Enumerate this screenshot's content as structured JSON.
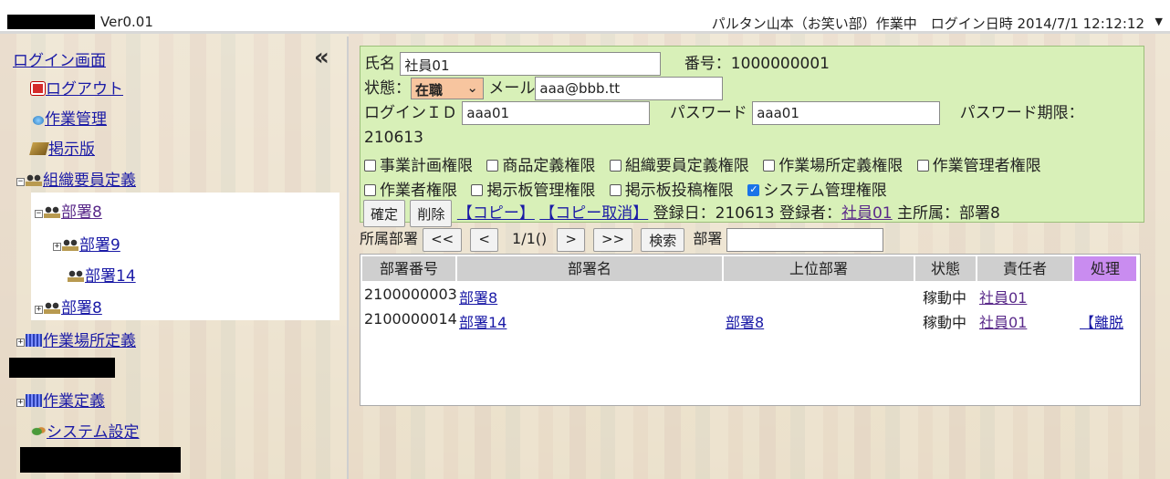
{
  "header": {
    "version": "Ver0.01",
    "status_text": "パルタン山本（お笑い部）作業中　ログイン日時 2014/7/1 12:12:12",
    "dropdown_icon": "triangle-down-icon"
  },
  "sidebar": {
    "collapse_icon": "«",
    "items": [
      {
        "label": "ログイン画面"
      },
      {
        "label": "ログアウト"
      },
      {
        "label": "作業管理"
      },
      {
        "label": "掲示版"
      },
      {
        "label": "組織要員定義"
      },
      {
        "label": "部署8"
      },
      {
        "label": "部署9"
      },
      {
        "label": "部署14"
      },
      {
        "label": "部署8"
      },
      {
        "label": "作業場所定義"
      },
      {
        "label": "作業定義"
      },
      {
        "label": "システム設定"
      }
    ]
  },
  "form": {
    "name_label": "氏名",
    "name_value": "社員01",
    "number_label": "番号：1000000001",
    "status_label": "状態：",
    "status_value": "在職",
    "mail_label": "メール",
    "mail_value": "aaa@bbb.tt",
    "login_id_label": "ログインＩＤ",
    "login_id_value": "aaa01",
    "password_label": "パスワード",
    "password_value": "aaa01",
    "password_expiry_label": "パスワード期限：",
    "password_expiry_value": "210613",
    "permissions": [
      {
        "label": "事業計画権限",
        "checked": false
      },
      {
        "label": "商品定義権限",
        "checked": false
      },
      {
        "label": "組織要員定義権限",
        "checked": false
      },
      {
        "label": "作業場所定義権限",
        "checked": false
      },
      {
        "label": "作業管理者権限",
        "checked": false
      },
      {
        "label": "作業者権限",
        "checked": false
      },
      {
        "label": "掲示板管理権限",
        "checked": false
      },
      {
        "label": "掲示板投稿権限",
        "checked": false
      },
      {
        "label": "システム管理権限",
        "checked": true
      }
    ],
    "confirm_button": "確定",
    "delete_button": "削除",
    "copy_link": "【コピー】",
    "copy_cancel_link": "【コピー取消】",
    "registered_text": "登録日：210613 登録者：",
    "registrant": "社員01",
    "main_affiliation": "主所属：部署8"
  },
  "paging": {
    "label": "所属部署",
    "first": "<<",
    "prev": "<",
    "page": "1/1()",
    "next": ">",
    "last": ">>",
    "search_button": "検索",
    "dept_label": "部署",
    "dept_value": ""
  },
  "table": {
    "headers": [
      "部署番号",
      "部署名",
      "上位部署",
      "状態",
      "責任者",
      "処理"
    ],
    "rows": [
      {
        "number": "2100000003",
        "name": "部署8",
        "parent": "",
        "state": "稼動中",
        "owner": "社員01",
        "action": ""
      },
      {
        "number": "2100000014",
        "name": "部署14",
        "parent": "部署8",
        "state": "稼動中",
        "owner": "社員01",
        "action": "【離脱"
      }
    ]
  },
  "colors": {
    "form_bg": "#d8f0b8",
    "action_header": "#c98cf0",
    "status_select": "#f7c59f",
    "link": "#1a1aa6"
  }
}
